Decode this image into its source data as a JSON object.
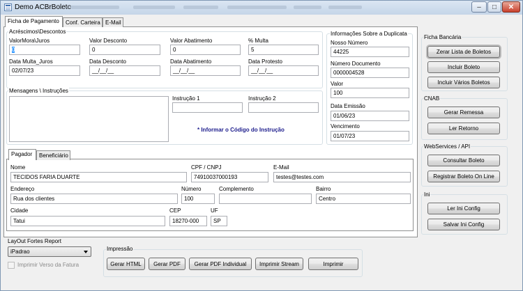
{
  "window": {
    "title": "Demo ACBrBoleto",
    "minimize_glyph": "–",
    "maximize_glyph": "□",
    "close_glyph": "✕"
  },
  "tabs": [
    "Ficha de Pagamento",
    "Conf. Carteira",
    "E-Mail"
  ],
  "acrescimos": {
    "legend": "Acréscimos\\Descontos",
    "valor_mora_label": "ValorMora\\Juros",
    "valor_mora": "0",
    "valor_desconto_label": "Valor Desconto",
    "valor_desconto": "0",
    "valor_abatimento_label": "Valor Abatimento",
    "valor_abatimento": "0",
    "multa_label": "% Multa",
    "multa": "5",
    "data_multa_label": "Data Multa_Juros",
    "data_multa": "02/07/23",
    "data_desconto_label": "Data Desconto",
    "data_desconto": "__/__/__",
    "data_abatimento_label": "Data Abatimento",
    "data_abatimento": "__/__/__",
    "data_protesto_label": "Data Protesto",
    "data_protesto": "__/__/__"
  },
  "mensagens": {
    "legend": "Mensagens \\ Instruções",
    "instrucao1_label": "Instrução 1",
    "instrucao1": "",
    "instrucao2_label": "Instrução 2",
    "instrucao2": "",
    "note": "* Informar o Código do Instrução"
  },
  "duplicata": {
    "legend": "Informações Sobre a Duplicata",
    "nosso_numero_label": "Nosso Número",
    "nosso_numero": "44225",
    "numero_documento_label": "Número Documento",
    "numero_documento": "0000004528",
    "valor_label": "Valor",
    "valor": "100",
    "data_emissao_label": "Data Emissão",
    "data_emissao": "01/06/23",
    "vencimento_label": "Vencimento",
    "vencimento": "01/07/23"
  },
  "pagador_tabs": [
    "Pagador",
    "Beneficiário"
  ],
  "pagador": {
    "nome_label": "Nome",
    "nome": "TECIDOS FARIA DUARTE",
    "cpf_label": "CPF / CNPJ",
    "cpf": "74910037000193",
    "email_label": "E-Mail",
    "email": "testes@testes.com",
    "endereco_label": "Endereço",
    "endereco": "Rua dos clientes",
    "numero_label": "Número",
    "numero": "100",
    "complemento_label": "Complemento",
    "complemento": "",
    "bairro_label": "Bairro",
    "bairro": "Centro",
    "cidade_label": "Cidade",
    "cidade": "Tatui",
    "cep_label": "CEP",
    "cep": "18270-000",
    "uf_label": "UF",
    "uf": "SP"
  },
  "ficha_bancaria": {
    "legend": "Ficha Bancária",
    "zerar": "Zerar Lista de Boletos",
    "incluir": "Incluir Boleto",
    "incluir_varios": "Incluir Vários Boletos"
  },
  "cnab": {
    "legend": "CNAB",
    "gerar_remessa": "Gerar Remessa",
    "ler_retorno": "Ler Retorno"
  },
  "webservices": {
    "legend": "WebServices / API",
    "consultar": "Consultar Boleto",
    "registrar": "Registrar Boleto On Line"
  },
  "ini": {
    "legend": "Ini",
    "ler": "Ler Ini Config",
    "salvar": "Salvar Ini Config"
  },
  "layout": {
    "label": "LayOut Fortes Report",
    "selected": "iPadrao",
    "imprimir_verso": "Imprimir Verso da Fatura"
  },
  "impressao": {
    "legend": "Impressão",
    "html": "Gerar HTML",
    "pdf": "Gerar PDF",
    "pdf_individual": "Gerar PDF Individual",
    "stream": "Imprimir Stream",
    "imprimir": "Imprimir"
  }
}
